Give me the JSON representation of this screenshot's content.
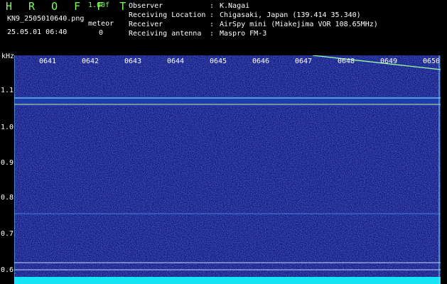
{
  "header": {
    "app_name": "H R O F F T",
    "version": "1.00f",
    "filename": "KN9_2505010640.png",
    "meteor_label": "meteor",
    "datetime": "25.05.01 06:40",
    "meteor_count": "0",
    "info": [
      {
        "label": "Observer",
        "value": "K.Nagai"
      },
      {
        "label": "Receiving Location",
        "value": "Chigasaki, Japan (139.414 35.340)"
      },
      {
        "label": "Receiver",
        "value": "AirSpy mini (Miakejima VOR 108.65MHz)"
      },
      {
        "label": "Receiving antenna",
        "value": "Maspro FM-3"
      }
    ]
  },
  "plot": {
    "unit": "kHz",
    "y_ticks": [
      "1.1",
      "1.0",
      "0.9",
      "0.8",
      "0.7",
      "0.6"
    ],
    "time_ticks": [
      "0641",
      "0642",
      "0643",
      "0644",
      "0645",
      "0646",
      "0647",
      "0648",
      "0649",
      "0650"
    ],
    "background_color": "#10197a",
    "carrier_color": "#ff5050"
  }
}
